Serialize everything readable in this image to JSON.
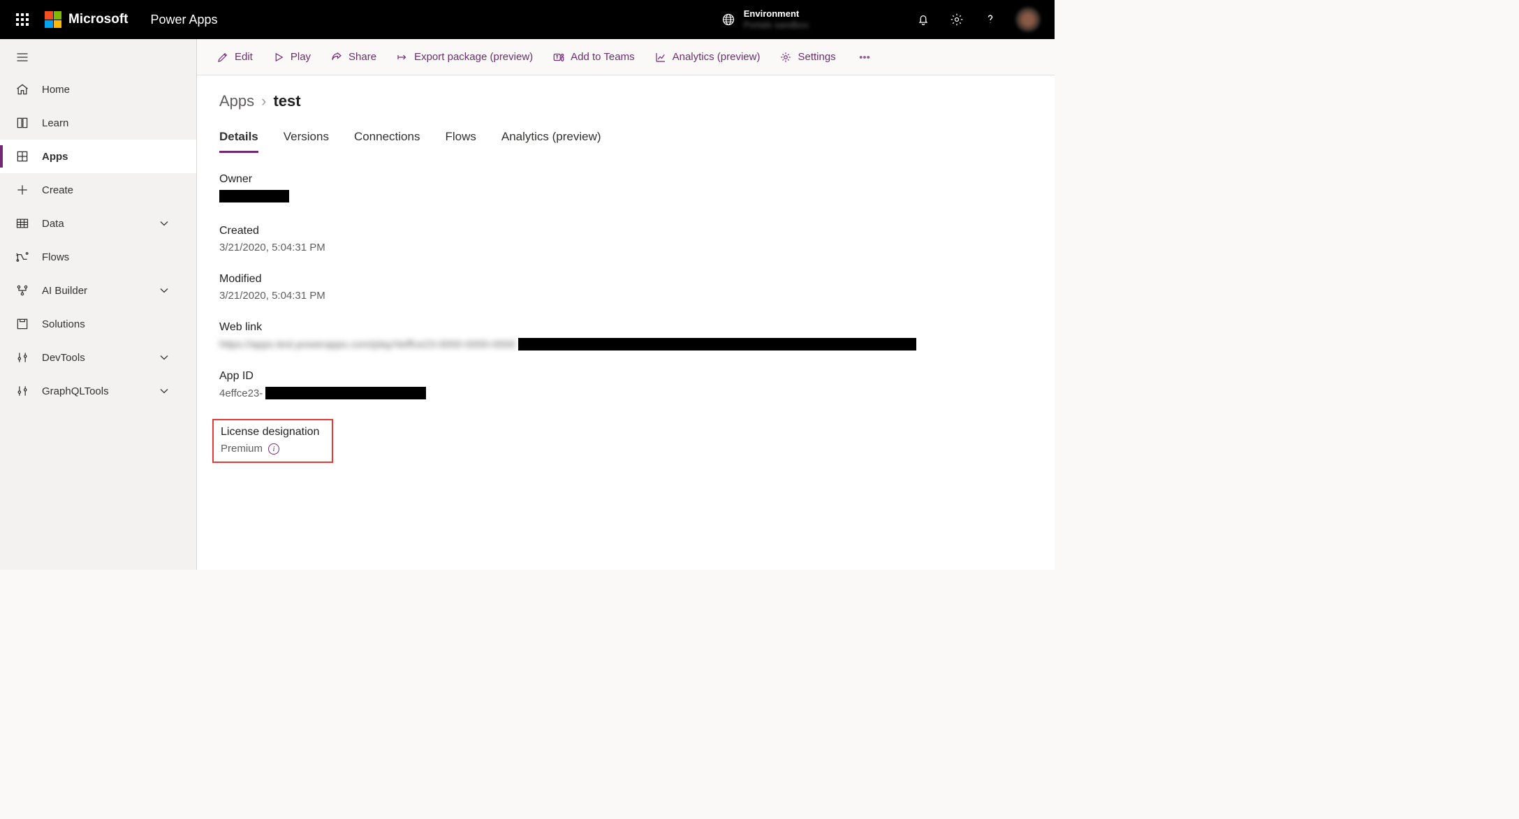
{
  "header": {
    "brand": "Microsoft",
    "app_title": "Power Apps",
    "env_label": "Environment",
    "env_name": "Portals sandbox"
  },
  "sidebar": {
    "items": [
      {
        "label": "Home"
      },
      {
        "label": "Learn"
      },
      {
        "label": "Apps"
      },
      {
        "label": "Create"
      },
      {
        "label": "Data"
      },
      {
        "label": "Flows"
      },
      {
        "label": "AI Builder"
      },
      {
        "label": "Solutions"
      },
      {
        "label": "DevTools"
      },
      {
        "label": "GraphQLTools"
      }
    ]
  },
  "commands": {
    "edit": "Edit",
    "play": "Play",
    "share": "Share",
    "export": "Export package (preview)",
    "teams": "Add to Teams",
    "analytics": "Analytics (preview)",
    "settings": "Settings"
  },
  "breadcrumb": {
    "root": "Apps",
    "current": "test"
  },
  "tabs": [
    "Details",
    "Versions",
    "Connections",
    "Flows",
    "Analytics (preview)"
  ],
  "details": {
    "owner_label": "Owner",
    "created_label": "Created",
    "created_value": "3/21/2020, 5:04:31 PM",
    "modified_label": "Modified",
    "modified_value": "3/21/2020, 5:04:31 PM",
    "weblink_label": "Web link",
    "weblink_prefix_blurred": "https://apps.test.powerapps.com/play/4effce23-0000-0000-0000",
    "appid_label": "App ID",
    "appid_prefix": "4effce23-",
    "license_label": "License designation",
    "license_value": "Premium"
  }
}
